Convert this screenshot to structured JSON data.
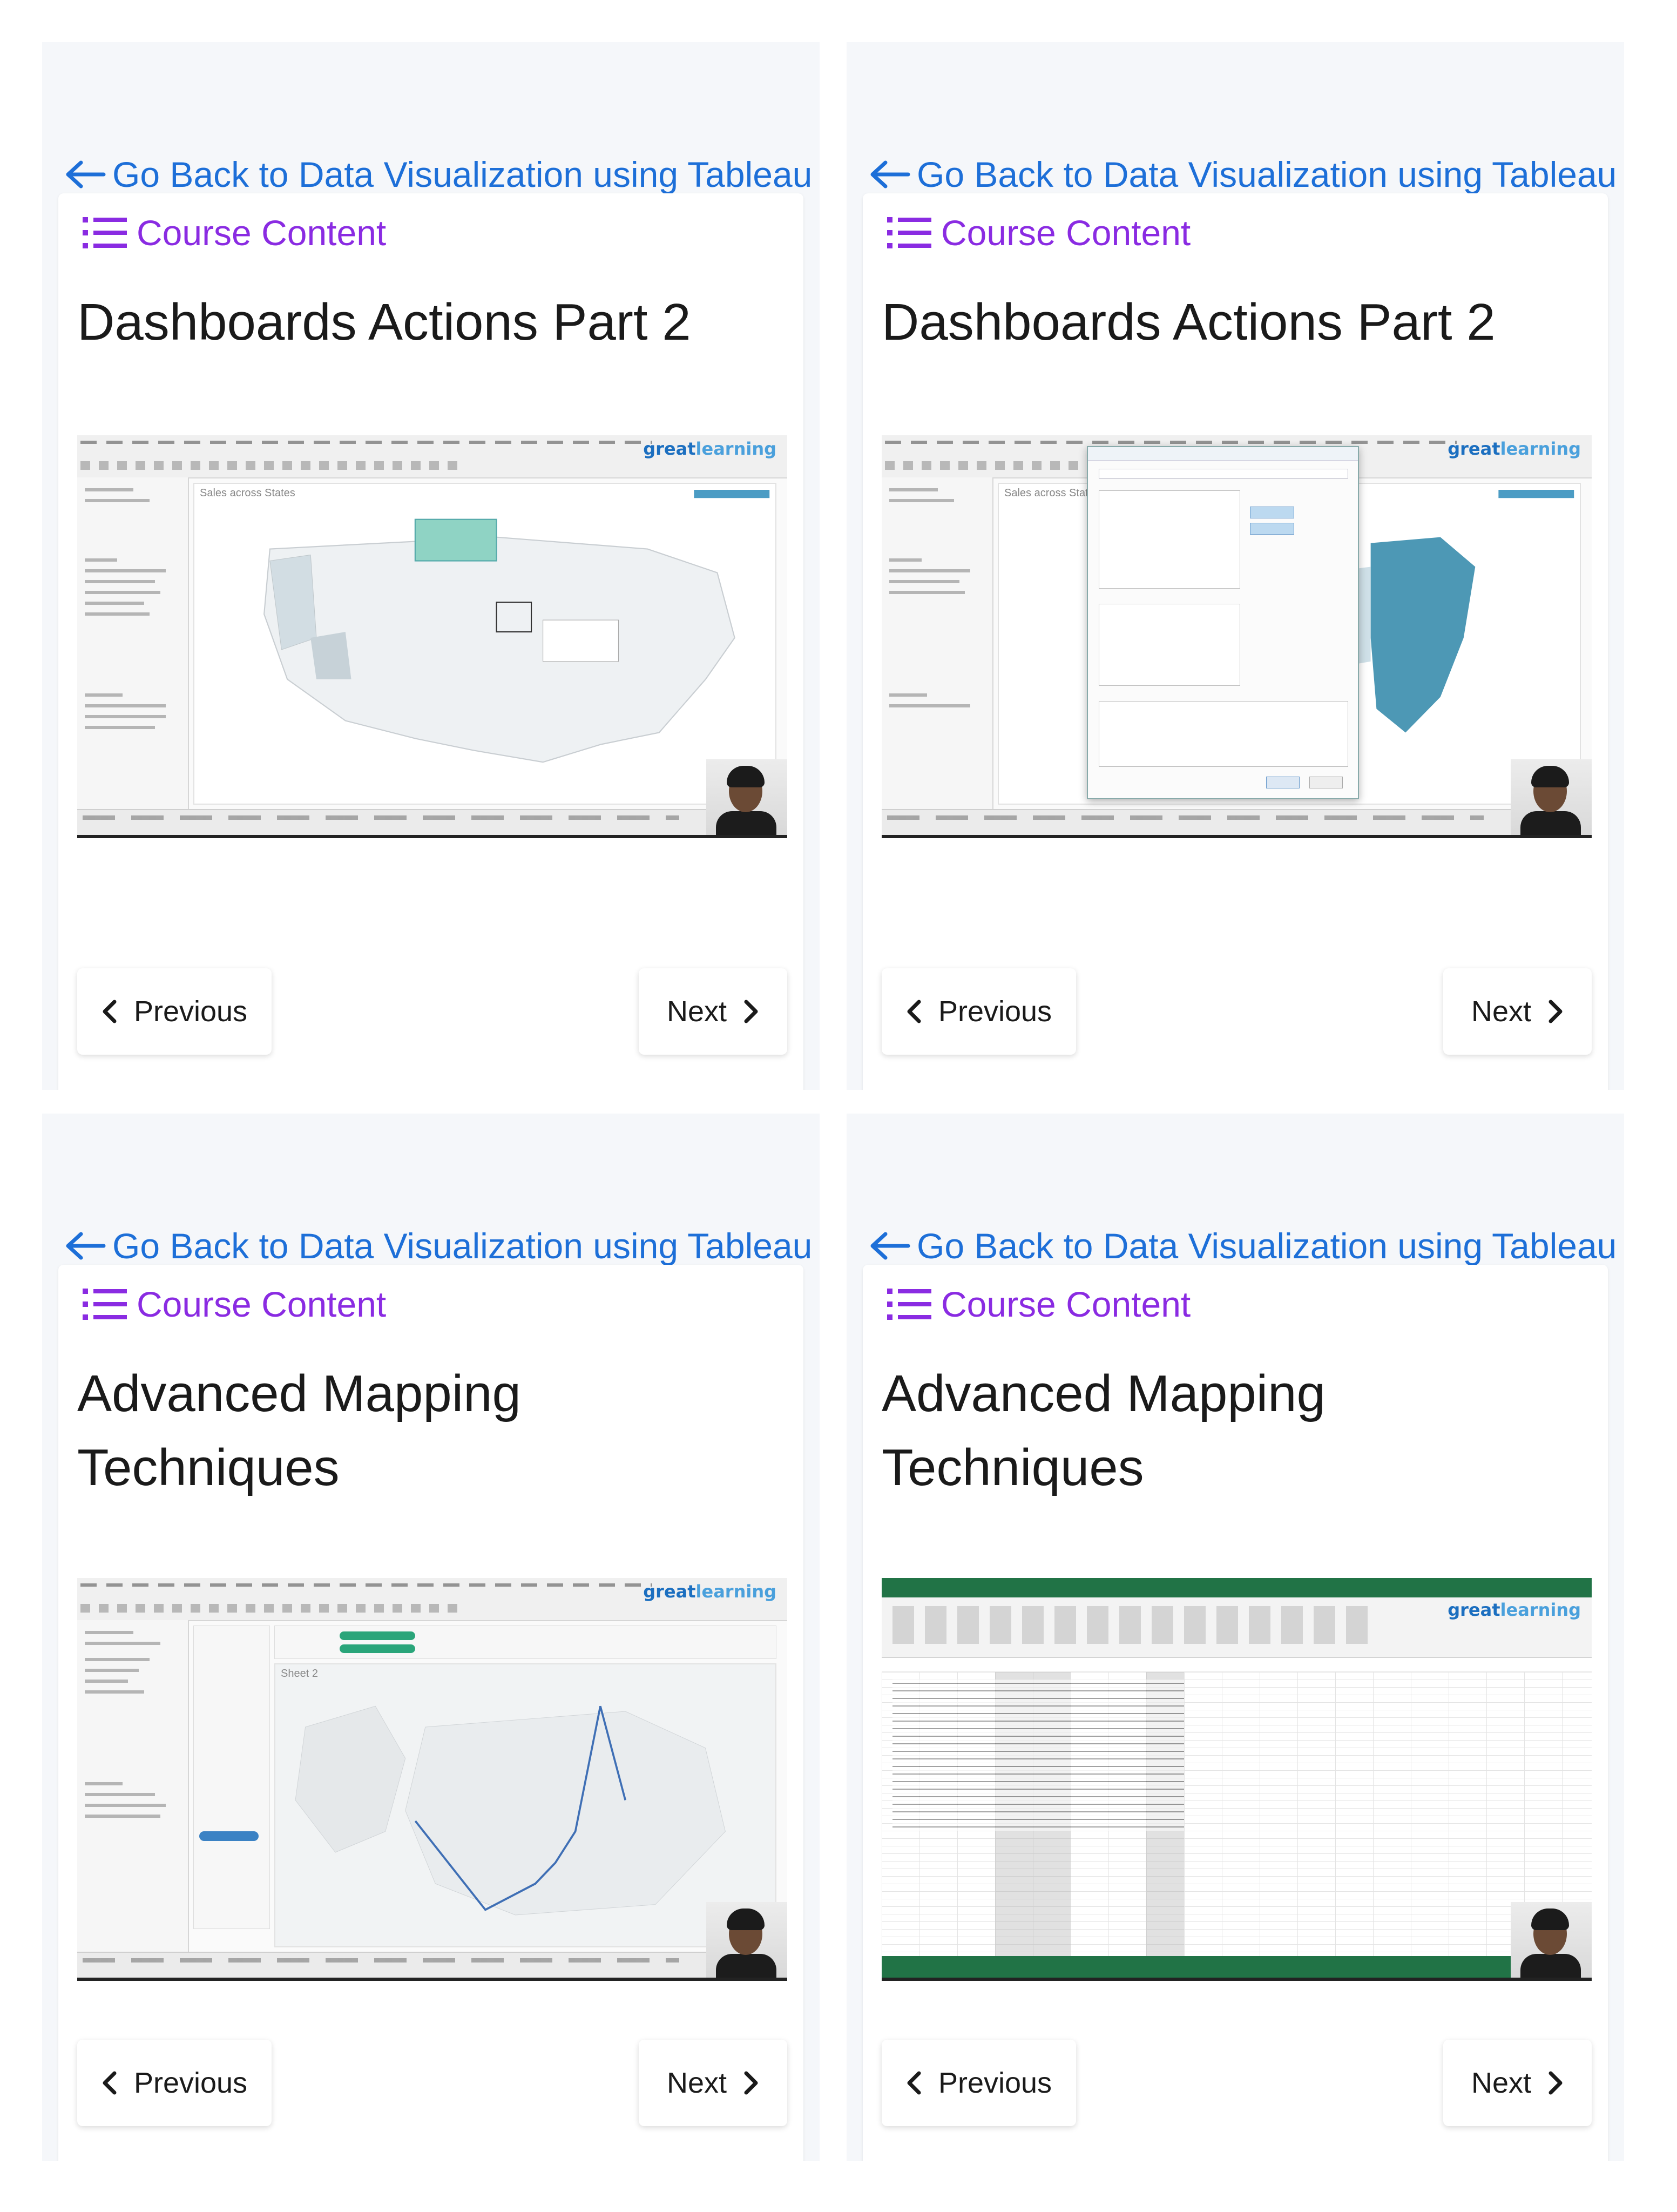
{
  "panels": [
    {
      "back_link": "Go Back to Data Visualization using Tableau",
      "course_content": "Course Content",
      "lesson_title": "Dashboards Actions Part 2",
      "video": {
        "brand_prefix": "great",
        "brand_suffix": "learning",
        "sheet_title": "Sales across States",
        "screen": "map-usa"
      },
      "prev_label": "Previous",
      "next_label": "Next"
    },
    {
      "back_link": "Go Back to Data Visualization using Tableau",
      "course_content": "Course Content",
      "lesson_title": "Dashboards Actions Part 2",
      "video": {
        "brand_prefix": "great",
        "brand_suffix": "learning",
        "sheet_title": "Sales across States",
        "screen": "filter-dialog"
      },
      "prev_label": "Previous",
      "next_label": "Next"
    },
    {
      "back_link": "Go Back to Data Visualization using Tableau",
      "course_content": "Course Content",
      "lesson_title": "Advanced Mapping Techniques",
      "video": {
        "brand_prefix": "great",
        "brand_suffix": "learning",
        "sheet_title": "Sheet 2",
        "screen": "map-europe"
      },
      "prev_label": "Previous",
      "next_label": "Next"
    },
    {
      "back_link": "Go Back to Data Visualization using Tableau",
      "course_content": "Course Content",
      "lesson_title": "Advanced Mapping Techniques",
      "video": {
        "brand_prefix": "great",
        "brand_suffix": "learning",
        "sheet_title": "",
        "screen": "excel"
      },
      "prev_label": "Previous",
      "next_label": "Next"
    }
  ],
  "colors": {
    "link_blue": "#1d6fd8",
    "course_purple": "#8a2be2",
    "panel_bg": "#f5f7fa",
    "excel_green": "#217346"
  },
  "icons": {
    "back": "arrow-left-icon",
    "course_content": "list-icon",
    "previous": "chevron-left-icon",
    "next": "chevron-right-icon"
  }
}
